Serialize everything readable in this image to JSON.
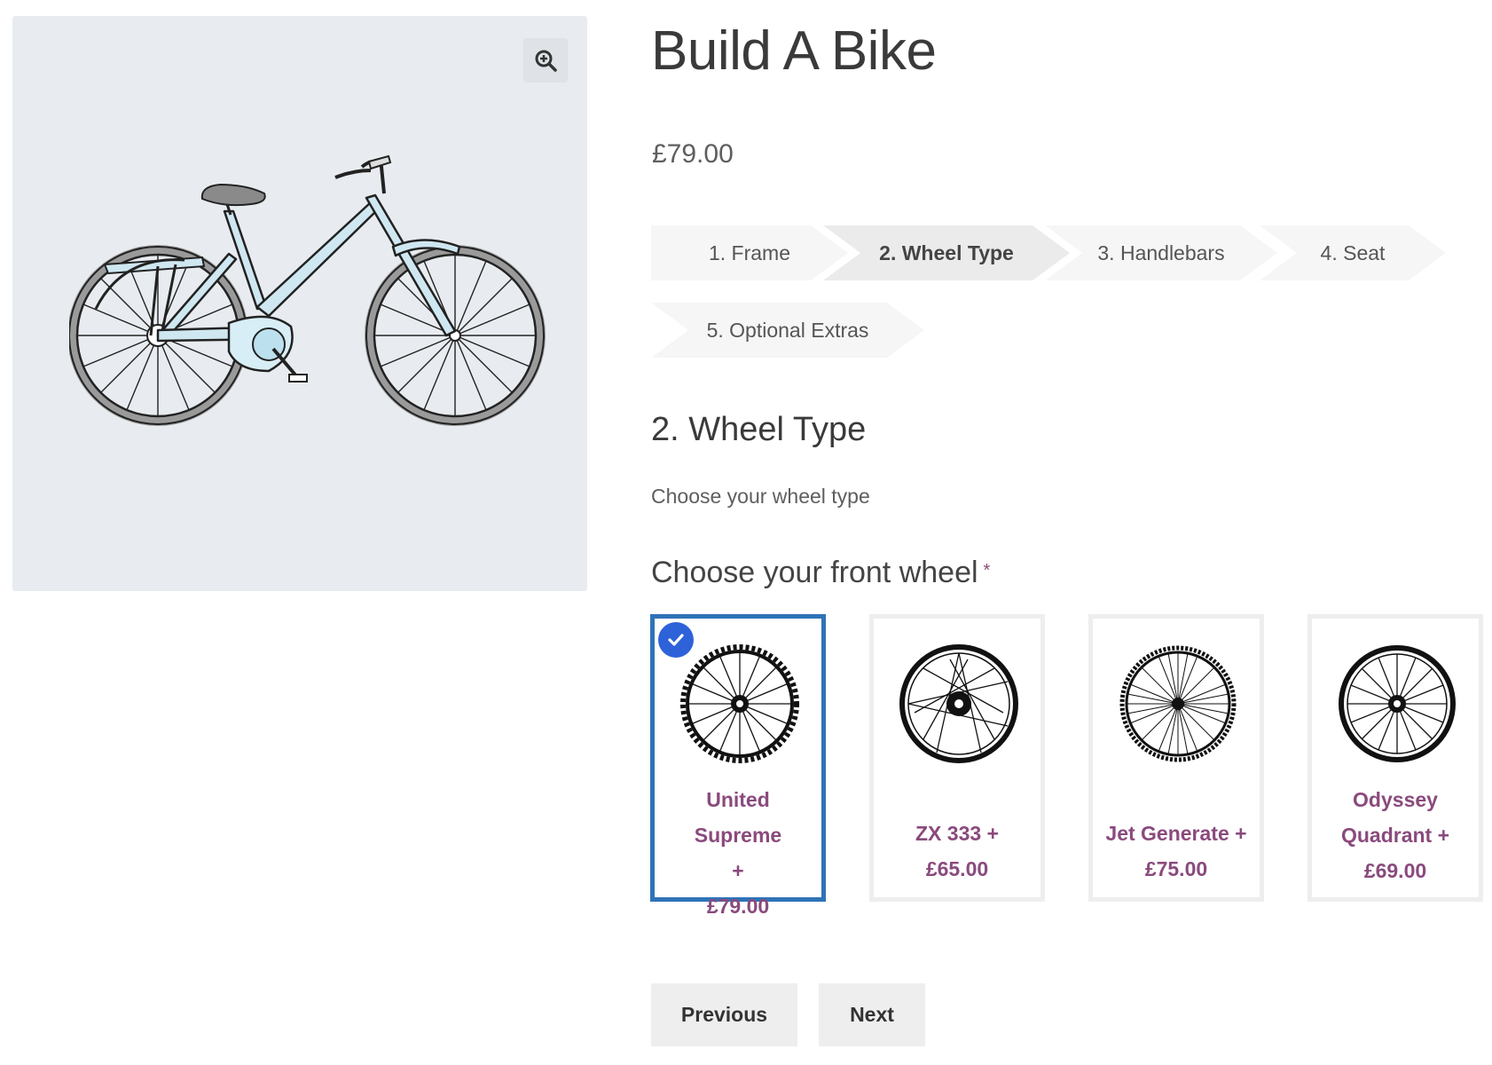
{
  "product": {
    "title": "Build A Bike",
    "price": "£79.00"
  },
  "steps": [
    {
      "label": "1. Frame",
      "active": false
    },
    {
      "label": "2. Wheel Type",
      "active": true
    },
    {
      "label": "3. Handlebars",
      "active": false
    },
    {
      "label": "4. Seat",
      "active": false
    },
    {
      "label": "5. Optional Extras",
      "active": false
    }
  ],
  "section": {
    "heading": "2. Wheel Type",
    "description": "Choose your wheel type"
  },
  "field": {
    "label": "Choose your front wheel",
    "required_mark": "*"
  },
  "options": [
    {
      "name": "United Supreme +",
      "price": "£79.00",
      "selected": true
    },
    {
      "name": "ZX 333 +",
      "price": "£65.00",
      "selected": false
    },
    {
      "name": "Jet Generate +",
      "price": "£75.00",
      "selected": false
    },
    {
      "name": "Odyssey Quadrant +",
      "price": "£69.00",
      "selected": false
    }
  ],
  "buttons": {
    "previous": "Previous",
    "next": "Next"
  },
  "icons": {
    "zoom": "zoom-in-icon",
    "check": "checkmark-icon"
  },
  "colors": {
    "accent_purple": "#8a4a7d",
    "selected_border": "#2f73b8",
    "check_badge": "#2d62d9"
  }
}
